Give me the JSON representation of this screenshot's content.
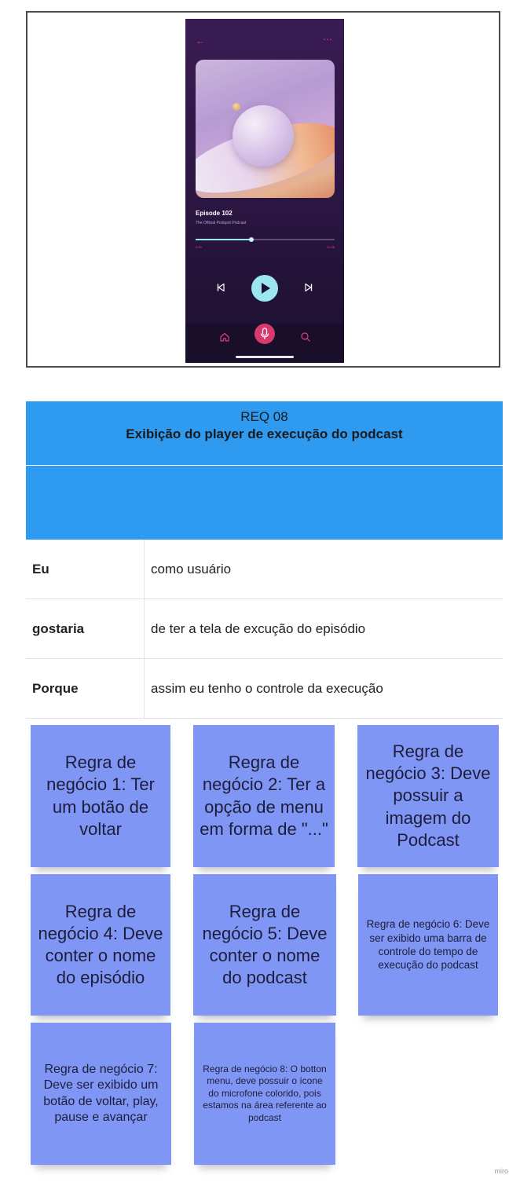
{
  "phone": {
    "episode_title": "Episode 102",
    "podcast_name": "The Official Podspot Podcast",
    "time_elapsed": "0:00",
    "time_total": "31:36",
    "progress": 0.4,
    "colors": {
      "accent": "#e0407a",
      "play": "#9be7f0",
      "background": "#2e1745"
    },
    "icons": [
      "back-arrow-icon",
      "more-options-icon",
      "previous-icon",
      "play-icon",
      "next-icon",
      "home-icon",
      "microphone-icon",
      "search-icon"
    ]
  },
  "requirement": {
    "id": "REQ 08",
    "title": "Exibição do player de execução do podcast",
    "rows": [
      {
        "key": "Eu",
        "value": "como usuário"
      },
      {
        "key": "gostaria",
        "value": "de ter a tela de excução do episódio"
      },
      {
        "key": "Porque",
        "value": "assim eu tenho o controle da execução"
      }
    ],
    "header_color": "#2f9bf0"
  },
  "notes": [
    "Regra de negócio 1: Ter um botão de voltar",
    "Regra de negócio 2: Ter a opção de menu em forma de \"...\"",
    "Regra de negócio 3: Deve possuir a imagem do Podcast",
    "Regra de negócio 4: Deve conter o nome do episódio",
    "Regra de negócio 5: Deve conter o nome do podcast",
    "Regra de negócio 6: Deve ser exibido uma barra de controle do tempo de execução do podcast",
    "Regra de negócio 7: Deve ser exibido um botão de voltar, play, pause  e avançar",
    "Regra de negócio 8: O botton menu, deve possuir o ícone do microfone colorido, pois estamos na área referente ao podcast"
  ],
  "note_color": "#8096f5",
  "watermark": "miro"
}
